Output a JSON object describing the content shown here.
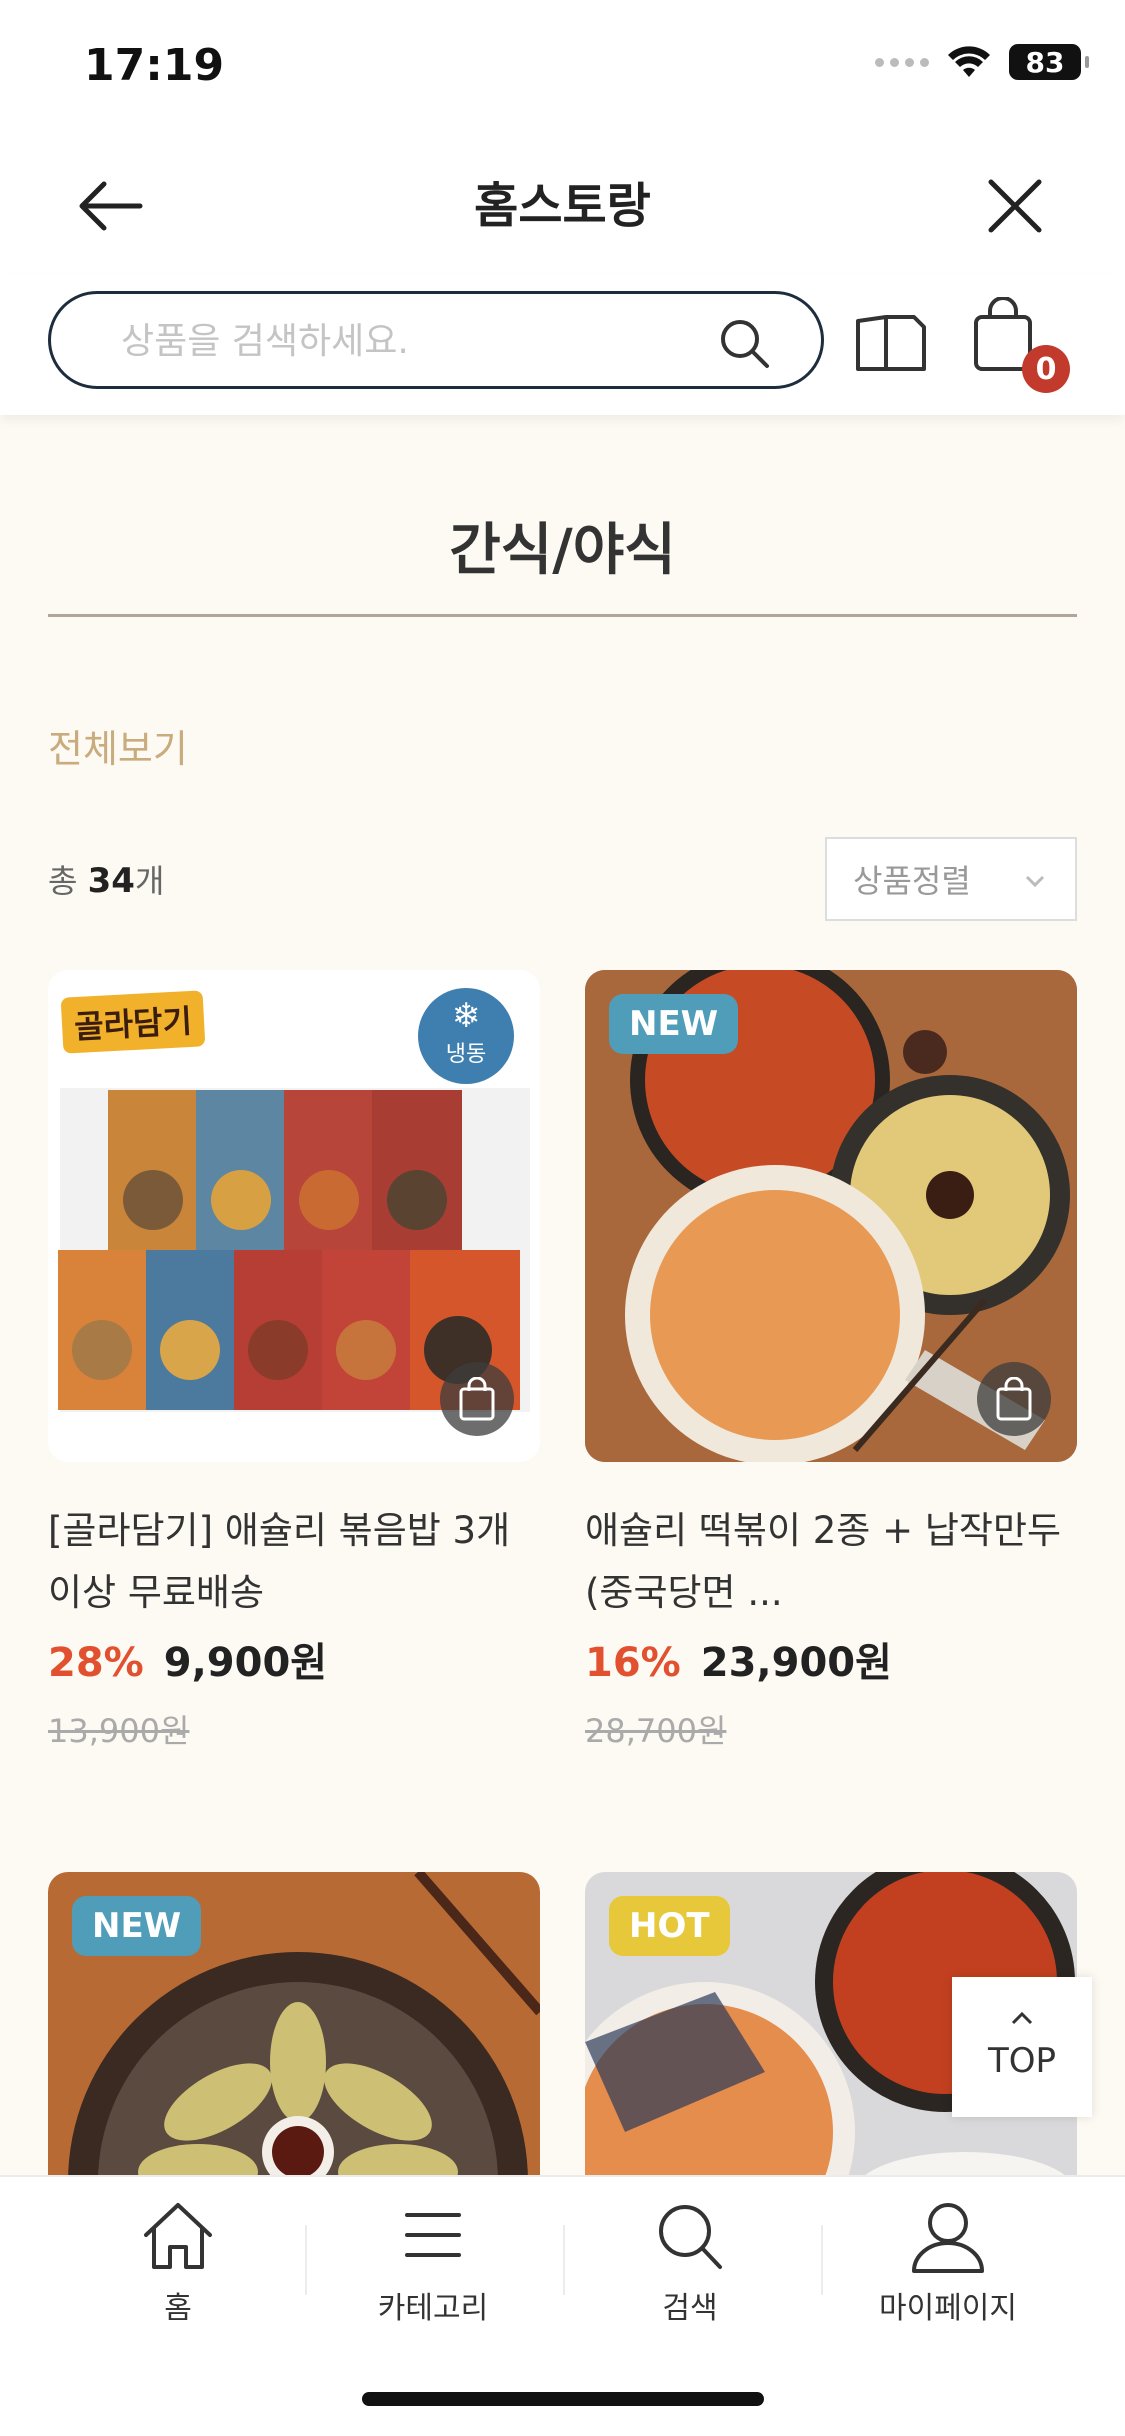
{
  "status_bar": {
    "time": "17:19",
    "battery": "83"
  },
  "header": {
    "title": "홈스토랑"
  },
  "search": {
    "placeholder": "상품을 검색하세요."
  },
  "cart": {
    "count": "0"
  },
  "category": {
    "title": "간식/야식",
    "view_all": "전체보기"
  },
  "list_info": {
    "total_prefix": "총",
    "total_count": "34",
    "total_suffix": "개",
    "sort_label": "상품정렬"
  },
  "products": [
    {
      "name": "[골라담기] 애슐리 볶음밥 3개이상 무료배송",
      "discount": "28%",
      "price": "9,900원",
      "original_price": "13,900원",
      "brand_tag": "골라담기",
      "storage_tag": "냉동",
      "badge": ""
    },
    {
      "name": "애슐리 떡볶이 2종 + 납작만두 (중국당면 ...",
      "discount": "16%",
      "price": "23,900원",
      "original_price": "28,700원",
      "badge": "NEW"
    },
    {
      "badge": "NEW"
    },
    {
      "badge": "HOT"
    }
  ],
  "top_button": {
    "label": "TOP"
  },
  "bottom_nav": [
    {
      "label": "홈",
      "icon": "home-icon"
    },
    {
      "label": "카테고리",
      "icon": "menu-icon"
    },
    {
      "label": "검색",
      "icon": "search-icon"
    },
    {
      "label": "마이페이지",
      "icon": "user-icon"
    }
  ]
}
